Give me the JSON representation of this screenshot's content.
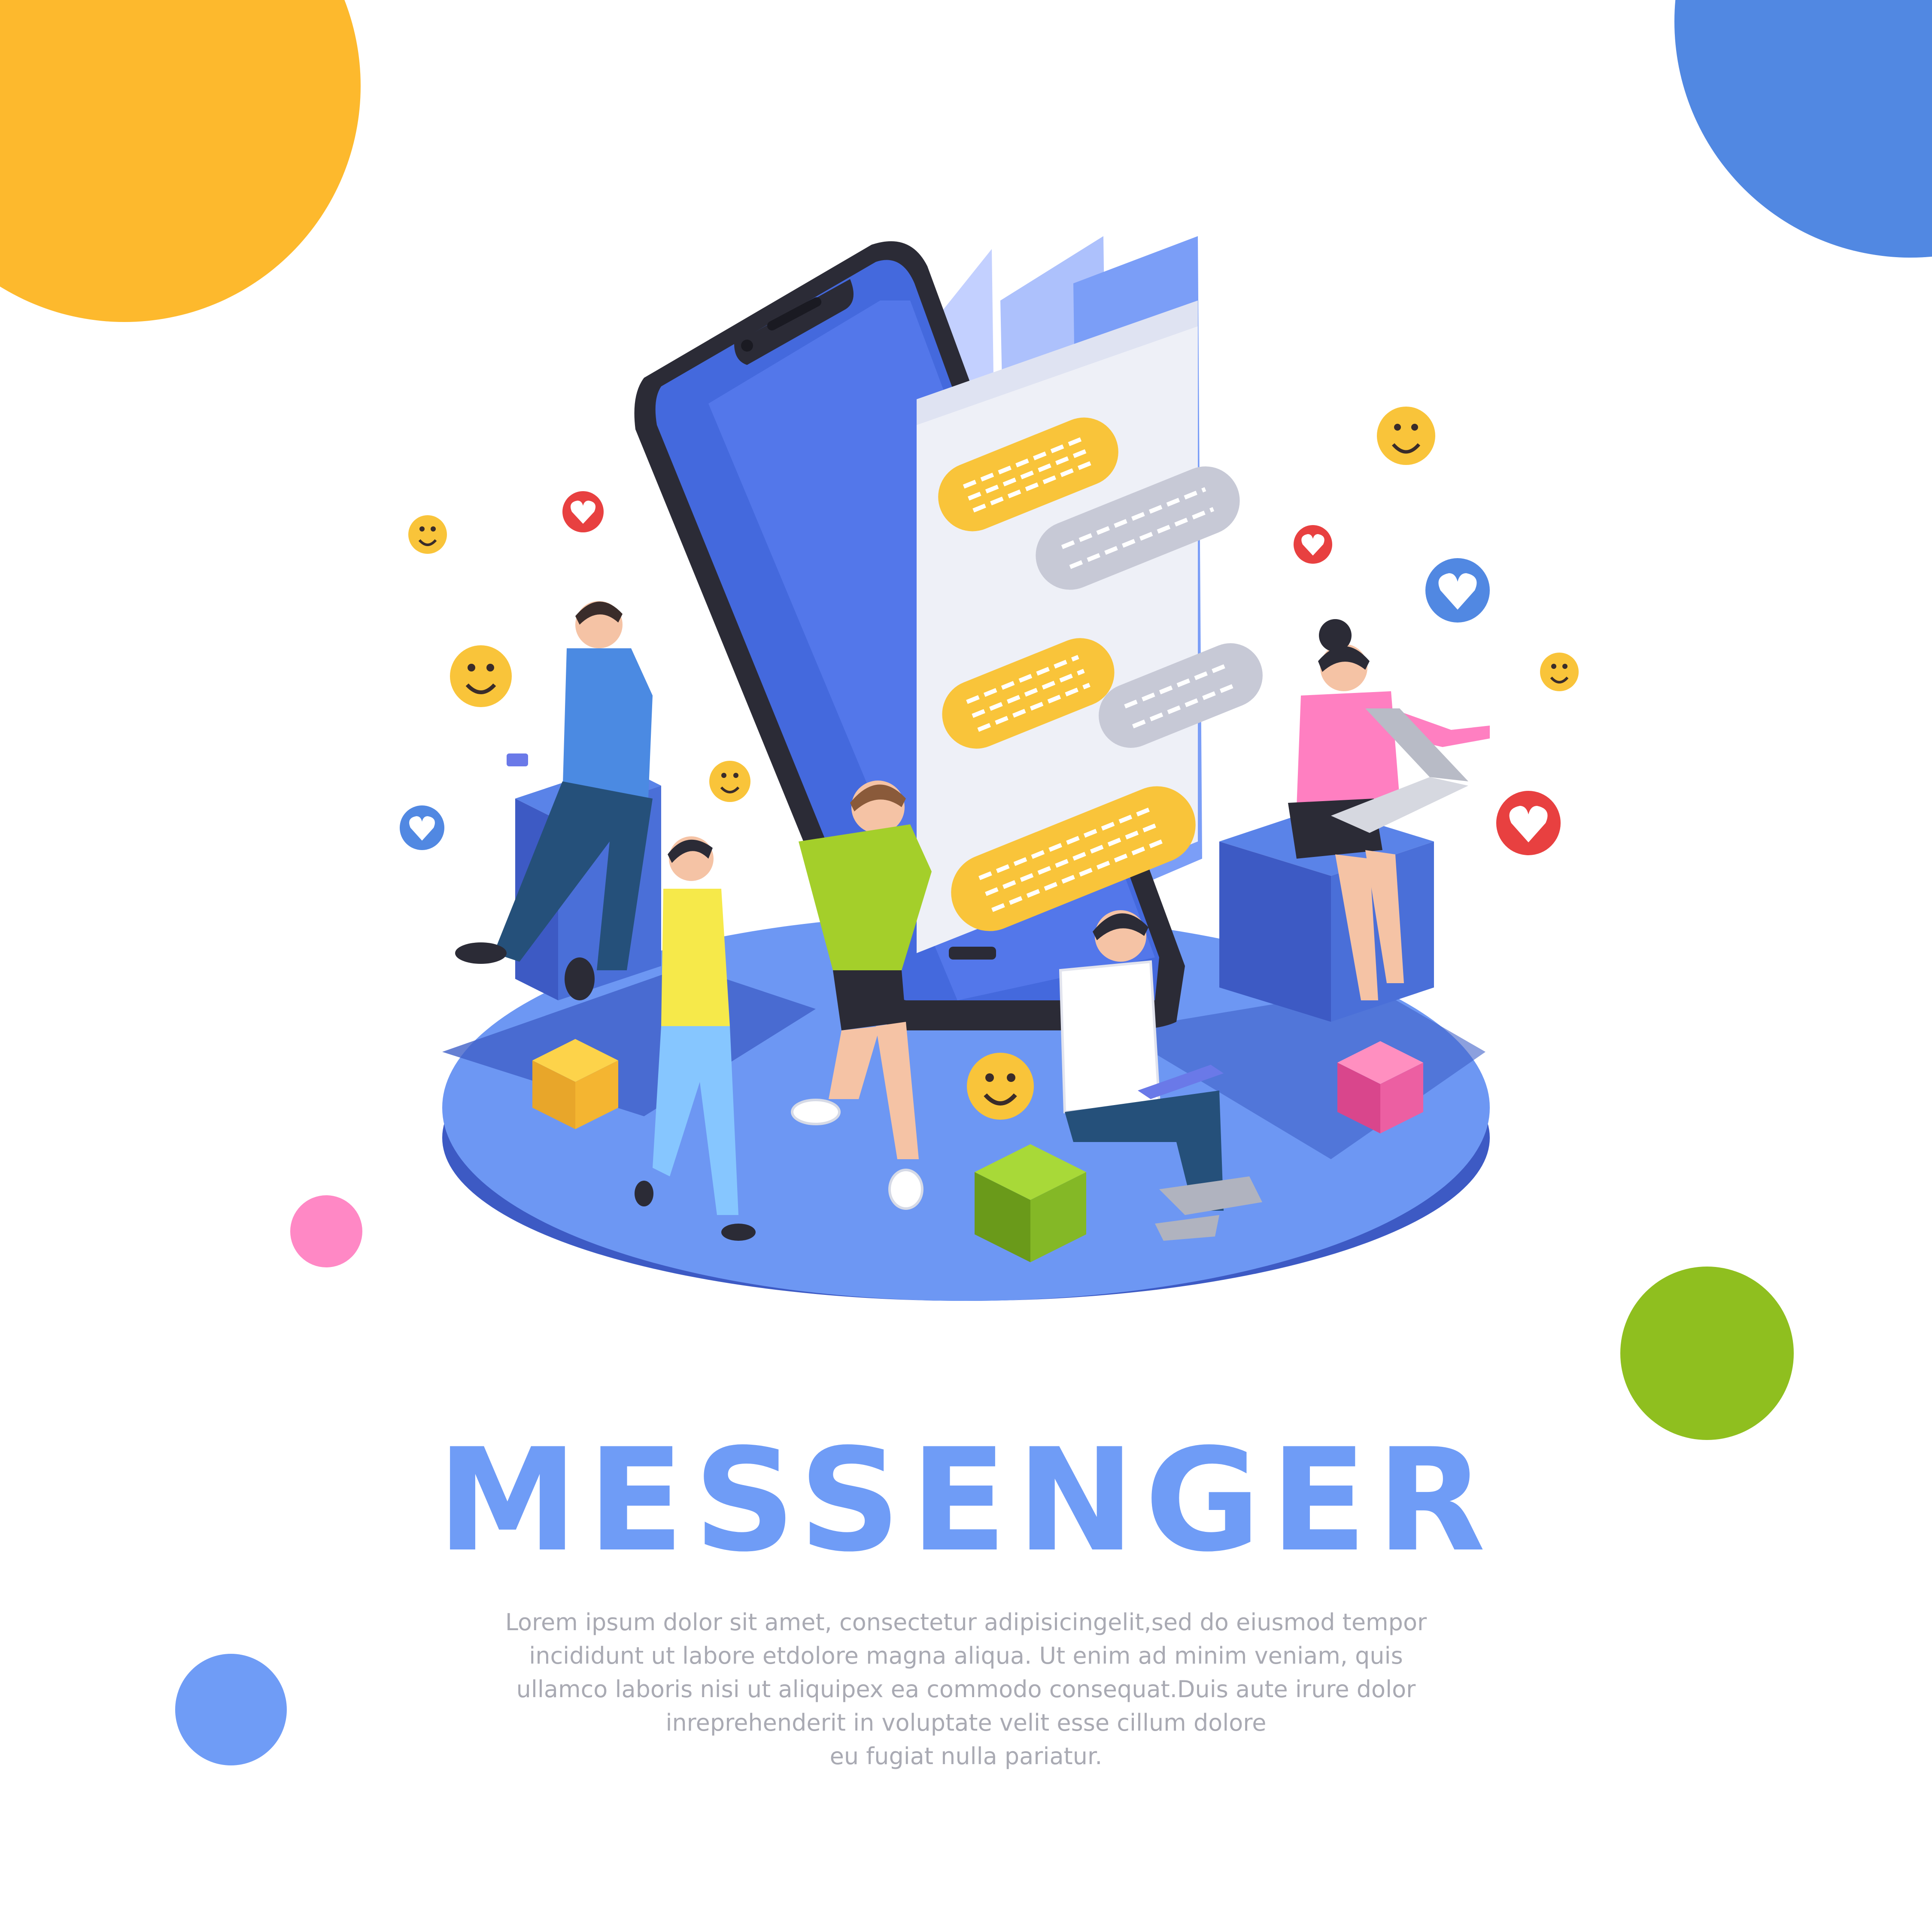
{
  "headline": "MESSENGER",
  "body_lines": [
    "Lorem ipsum dolor sit amet, consectetur adipisicingelit,sed do eiusmod tempor",
    "incididunt ut labore etdolore magna aliqua. Ut enim ad minim veniam, quis",
    "ullamco laboris nisi ut aliquipex ea commodo consequat.Duis aute irure dolor",
    "inreprehenderit in voluptate velit esse cillum dolore",
    "eu fugiat nulla pariatur."
  ],
  "colors": {
    "brand_blue": "#6f9cf6",
    "accent_yellow": "#fdb92d",
    "accent_blue": "#5188e2",
    "accent_pink": "#ff88c5",
    "accent_green": "#8fbf1f",
    "chat_yellow": "#f9c43a",
    "chat_grey": "#c7c9d6",
    "text_grey": "#a9aab3"
  },
  "icons": [
    "smiley-icon",
    "heart-icon"
  ]
}
